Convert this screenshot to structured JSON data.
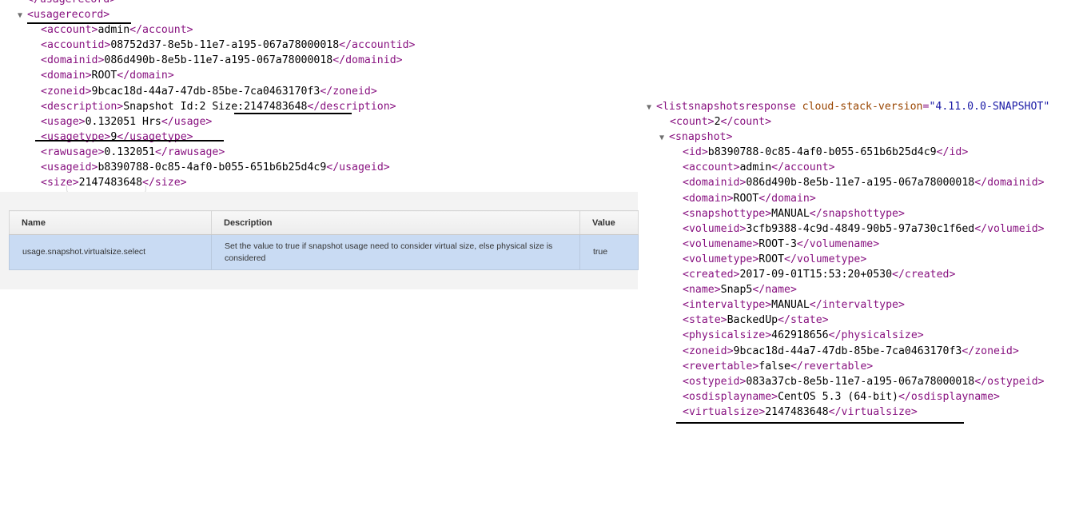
{
  "left": {
    "lines": [
      {
        "indent": 1,
        "tri": "",
        "open": "</usagerecord>",
        "text": "",
        "close": ""
      },
      {
        "indent": 0,
        "tri": "▼",
        "open": "<usagerecord>",
        "text": "",
        "close": ""
      },
      {
        "indent": 2,
        "tri": "",
        "open": "<account>",
        "text": "admin",
        "close": "</account>"
      },
      {
        "indent": 2,
        "tri": "",
        "open": "<accountid>",
        "text": "08752d37-8e5b-11e7-a195-067a78000018",
        "close": "</accountid>"
      },
      {
        "indent": 2,
        "tri": "",
        "open": "<domainid>",
        "text": "086d490b-8e5b-11e7-a195-067a78000018",
        "close": "</domainid>"
      },
      {
        "indent": 2,
        "tri": "",
        "open": "<domain>",
        "text": "ROOT",
        "close": "</domain>"
      },
      {
        "indent": 2,
        "tri": "",
        "open": "<zoneid>",
        "text": "9bcac18d-44a7-47db-85be-7ca0463170f3",
        "close": "</zoneid>"
      },
      {
        "indent": 2,
        "tri": "",
        "open": "<description>",
        "text": "Snapshot Id:2 Size:2147483648",
        "close": "</description>"
      },
      {
        "indent": 2,
        "tri": "",
        "open": "<usage>",
        "text": "0.132051 Hrs",
        "close": "</usage>"
      },
      {
        "indent": 2,
        "tri": "",
        "open": "<usagetype>",
        "text": "9",
        "close": "</usagetype>"
      },
      {
        "indent": 2,
        "tri": "",
        "open": "<rawusage>",
        "text": "0.132051",
        "close": "</rawusage>"
      },
      {
        "indent": 2,
        "tri": "",
        "open": "<usageid>",
        "text": "b8390788-0c85-4af0-b055-651b6b25d4c9",
        "close": "</usageid>"
      },
      {
        "indent": 2,
        "tri": "",
        "open": "<size>",
        "text": "2147483648",
        "close": "</size>"
      }
    ]
  },
  "settings": {
    "headers": [
      "Name",
      "Description",
      "Value"
    ],
    "row": {
      "name": "usage.snapshot.virtualsize.select",
      "description": "Set the value to true if snapshot usage need to consider virtual size, else physical size is considered",
      "value": "true"
    }
  },
  "right": {
    "root_open": "<listsnapshotsresponse",
    "root_attr_name": "cloud-stack-version",
    "root_attr_value": "\"4.11.0.0-SNAPSHOT\"",
    "lines": [
      {
        "indent": 1,
        "tri": "",
        "open": "<count>",
        "text": "2",
        "close": "</count>"
      },
      {
        "indent": 0,
        "tri": "▼",
        "open": "<snapshot>",
        "text": "",
        "close": "",
        "sub": true
      },
      {
        "indent": 2,
        "tri": "",
        "open": "<id>",
        "text": "b8390788-0c85-4af0-b055-651b6b25d4c9",
        "close": "</id>"
      },
      {
        "indent": 2,
        "tri": "",
        "open": "<account>",
        "text": "admin",
        "close": "</account>"
      },
      {
        "indent": 2,
        "tri": "",
        "open": "<domainid>",
        "text": "086d490b-8e5b-11e7-a195-067a78000018",
        "close": "</domainid>"
      },
      {
        "indent": 2,
        "tri": "",
        "open": "<domain>",
        "text": "ROOT",
        "close": "</domain>"
      },
      {
        "indent": 2,
        "tri": "",
        "open": "<snapshottype>",
        "text": "MANUAL",
        "close": "</snapshottype>"
      },
      {
        "indent": 2,
        "tri": "",
        "open": "<volumeid>",
        "text": "3cfb9388-4c9d-4849-90b5-97a730c1f6ed",
        "close": "</volumeid>"
      },
      {
        "indent": 2,
        "tri": "",
        "open": "<volumename>",
        "text": "ROOT-3",
        "close": "</volumename>"
      },
      {
        "indent": 2,
        "tri": "",
        "open": "<volumetype>",
        "text": "ROOT",
        "close": "</volumetype>"
      },
      {
        "indent": 2,
        "tri": "",
        "open": "<created>",
        "text": "2017-09-01T15:53:20+0530",
        "close": "</created>"
      },
      {
        "indent": 2,
        "tri": "",
        "open": "<name>",
        "text": "Snap5",
        "close": "</name>"
      },
      {
        "indent": 2,
        "tri": "",
        "open": "<intervaltype>",
        "text": "MANUAL",
        "close": "</intervaltype>"
      },
      {
        "indent": 2,
        "tri": "",
        "open": "<state>",
        "text": "BackedUp",
        "close": "</state>"
      },
      {
        "indent": 2,
        "tri": "",
        "open": "<physicalsize>",
        "text": "462918656",
        "close": "</physicalsize>"
      },
      {
        "indent": 2,
        "tri": "",
        "open": "<zoneid>",
        "text": "9bcac18d-44a7-47db-85be-7ca0463170f3",
        "close": "</zoneid>"
      },
      {
        "indent": 2,
        "tri": "",
        "open": "<revertable>",
        "text": "false",
        "close": "</revertable>"
      },
      {
        "indent": 2,
        "tri": "",
        "open": "<ostypeid>",
        "text": "083a37cb-8e5b-11e7-a195-067a78000018",
        "close": "</ostypeid>"
      },
      {
        "indent": 2,
        "tri": "",
        "open": "<osdisplayname>",
        "text": "CentOS 5.3 (64-bit)",
        "close": "</osdisplayname>"
      },
      {
        "indent": 2,
        "tri": "",
        "open": "<virtualsize>",
        "text": "2147483648",
        "close": "</virtualsize>"
      }
    ]
  }
}
